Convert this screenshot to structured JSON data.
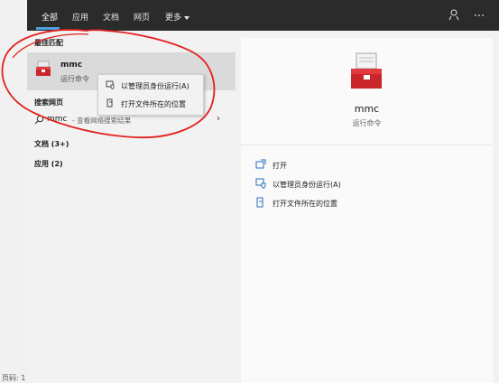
{
  "background": {
    "footer_text": "页码: 1"
  },
  "tabs": [
    {
      "label": "全部"
    },
    {
      "label": "应用"
    },
    {
      "label": "文档"
    },
    {
      "label": "网页"
    },
    {
      "label": "更多"
    }
  ],
  "top_icons": {
    "feedback": "feedback-icon",
    "more": "more-icon"
  },
  "results": {
    "best_match_title": "最佳匹配",
    "best_match": {
      "name": "mmc",
      "subtitle": "运行命令"
    },
    "web_title": "搜索网页",
    "web": {
      "query": "mmc",
      "suffix": "- 查看网络搜索结果"
    },
    "categories": [
      {
        "label": "文档 (3+)"
      },
      {
        "label": "应用 (2)"
      }
    ]
  },
  "context_menu": {
    "items": [
      {
        "label": "以管理员身份运行(A)",
        "icon": "shield-icon"
      },
      {
        "label": "打开文件所在的位置",
        "icon": "folder-icon"
      }
    ]
  },
  "detail": {
    "name": "mmc",
    "subtitle": "运行命令",
    "actions": [
      {
        "label": "打开",
        "icon": "open-icon"
      },
      {
        "label": "以管理员身份运行(A)",
        "icon": "shield-icon"
      },
      {
        "label": "打开文件所在的位置",
        "icon": "folder-icon"
      }
    ]
  },
  "colors": {
    "topbar": "#2b2b2b",
    "accent": "#4ea3e0",
    "annotation": "#e0201e",
    "selected_row": "#dadada"
  }
}
